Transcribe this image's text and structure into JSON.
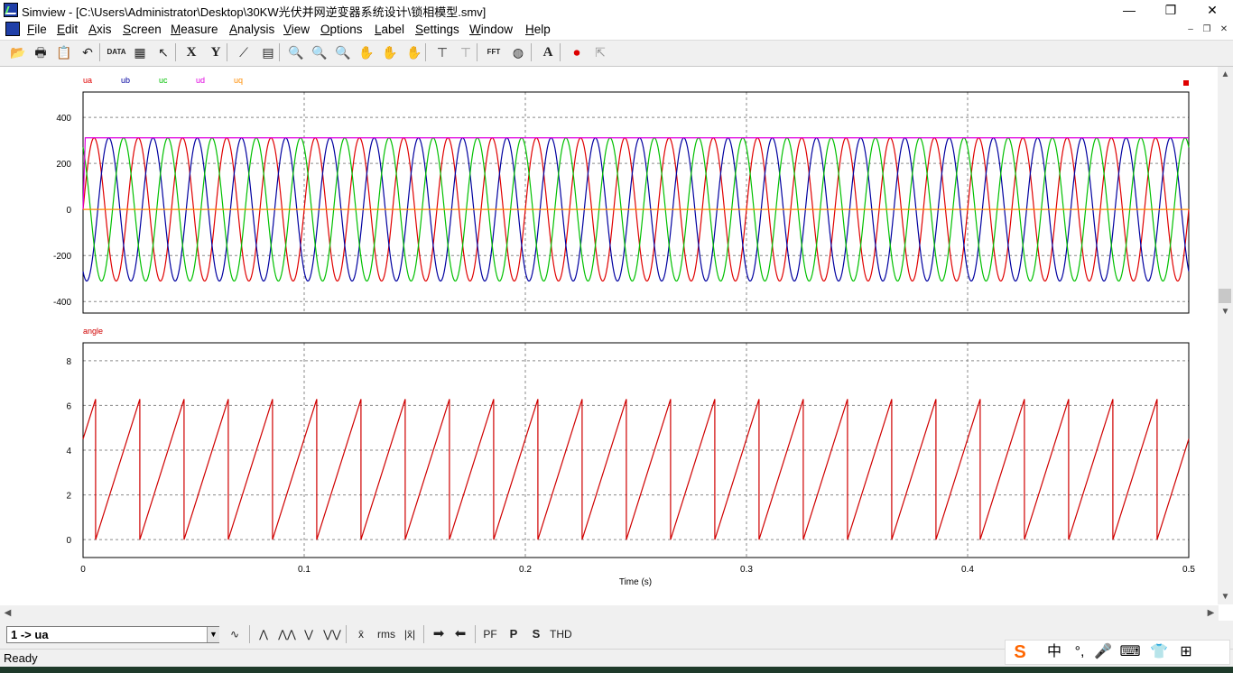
{
  "window": {
    "title": "Simview - [C:\\Users\\Administrator\\Desktop\\30KW光伏并网逆变器系统设计\\锁相模型.smv]",
    "controls": {
      "minimize": "—",
      "maximize": "❐",
      "close": "✕"
    },
    "mdi_controls": {
      "minimize": "–",
      "restore": "❐",
      "close": "✕"
    }
  },
  "menu": [
    "File",
    "Edit",
    "Axis",
    "Screen",
    "Measure",
    "Analysis",
    "View",
    "Options",
    "Label",
    "Settings",
    "Window",
    "Help"
  ],
  "toolbar": {
    "buttons": [
      {
        "icon": "open-folder-icon",
        "glyph": "📂"
      },
      {
        "icon": "print-icon",
        "glyph": "🖶"
      },
      {
        "icon": "clipboard-icon",
        "glyph": "📋"
      },
      {
        "icon": "undo-icon",
        "glyph": "↶"
      },
      {
        "icon": "data-disk-icon",
        "glyph": "DATA"
      },
      {
        "icon": "chart-edit-icon",
        "glyph": "▦"
      },
      {
        "icon": "pointer-icon",
        "glyph": "↖"
      },
      {
        "icon": "x-axis-icon",
        "glyph": "X"
      },
      {
        "icon": "y-axis-icon",
        "glyph": "Y"
      },
      {
        "icon": "plot-icon",
        "glyph": "⟋"
      },
      {
        "icon": "screen-grid-icon",
        "glyph": "▤"
      },
      {
        "icon": "zoom-icon",
        "glyph": "🔍"
      },
      {
        "icon": "zoom-in-icon",
        "glyph": "🔍"
      },
      {
        "icon": "zoom-out-icon",
        "glyph": "🔍"
      },
      {
        "icon": "pan-left-hand-icon",
        "glyph": "✋"
      },
      {
        "icon": "pan-right-hand-icon",
        "glyph": "✋"
      },
      {
        "icon": "grab-hand-icon",
        "glyph": "✋"
      },
      {
        "icon": "measure-tool-icon",
        "glyph": "⊤"
      },
      {
        "icon": "measure-tool-disabled-icon",
        "glyph": "⊤"
      },
      {
        "icon": "fft-icon",
        "glyph": "FFT"
      },
      {
        "icon": "globe-icon",
        "glyph": "◍"
      },
      {
        "icon": "label-text-icon",
        "glyph": "A"
      },
      {
        "icon": "record-icon",
        "glyph": "⏺"
      },
      {
        "icon": "export-icon",
        "glyph": "⇱"
      }
    ]
  },
  "colors": {
    "ua": "#e00000",
    "ub": "#0000a0",
    "uc": "#00c000",
    "ud": "#e000e0",
    "uq": "#ff8c00",
    "angle": "#d00000",
    "grid": "#8a8a8a"
  },
  "chart_data": [
    {
      "type": "line",
      "series": [
        {
          "name": "ua",
          "function": "311*sin(2*pi*50*t + 0.0)"
        },
        {
          "name": "ub",
          "function": "311*sin(2*pi*50*t - 2.094)"
        },
        {
          "name": "uc",
          "function": "311*sin(2*pi*50*t + 2.094)"
        },
        {
          "name": "ud",
          "values_constant": 311
        },
        {
          "name": "uq",
          "values_constant": 0
        }
      ],
      "ylim": [
        -450,
        510
      ],
      "yticks": [
        400,
        200,
        0,
        -200,
        -400
      ],
      "xlim": [
        0,
        0.5
      ],
      "grid": true,
      "legend": "top-left"
    },
    {
      "type": "line",
      "series": [
        {
          "name": "angle",
          "function": "sawtooth 0 to 6.28 at 50 Hz, starting at 4.5"
        }
      ],
      "ylim": [
        -0.8,
        8.8
      ],
      "yticks": [
        8,
        6,
        4,
        2,
        0
      ],
      "xlim": [
        0,
        0.5
      ],
      "xticks": [
        "0",
        "0.1",
        "0.2",
        "0.3",
        "0.4",
        "0.5"
      ],
      "xlabel": "Time (s)",
      "grid": true,
      "legend": "top-left"
    }
  ],
  "measure_bar": {
    "selected_series": "1 -> ua",
    "buttons": [
      {
        "icon": "wave-icon",
        "label": "∿"
      },
      {
        "icon": "max-icon",
        "label": "⋀"
      },
      {
        "icon": "local-max-icon",
        "label": "⋀⋀"
      },
      {
        "icon": "min-icon",
        "label": "⋁"
      },
      {
        "icon": "local-min-icon",
        "label": "⋁⋁"
      },
      {
        "icon": "mean-icon",
        "label": "x̄"
      },
      {
        "icon": "rms-icon",
        "label": "rms"
      },
      {
        "icon": "abs-mean-icon",
        "label": "|x̄|"
      },
      {
        "icon": "arrow-right-icon",
        "label": "➡"
      },
      {
        "icon": "arrow-left-icon",
        "label": "⬅"
      },
      {
        "icon": "pf-icon",
        "label": "PF"
      },
      {
        "icon": "p-icon",
        "label": "P"
      },
      {
        "icon": "s-icon",
        "label": "S"
      },
      {
        "icon": "thd-icon",
        "label": "THD"
      }
    ]
  },
  "status": {
    "text": "Ready"
  },
  "ime": {
    "items": [
      "S",
      "中",
      "°,",
      "🎤",
      "⌨",
      "👕",
      "⊞"
    ]
  }
}
